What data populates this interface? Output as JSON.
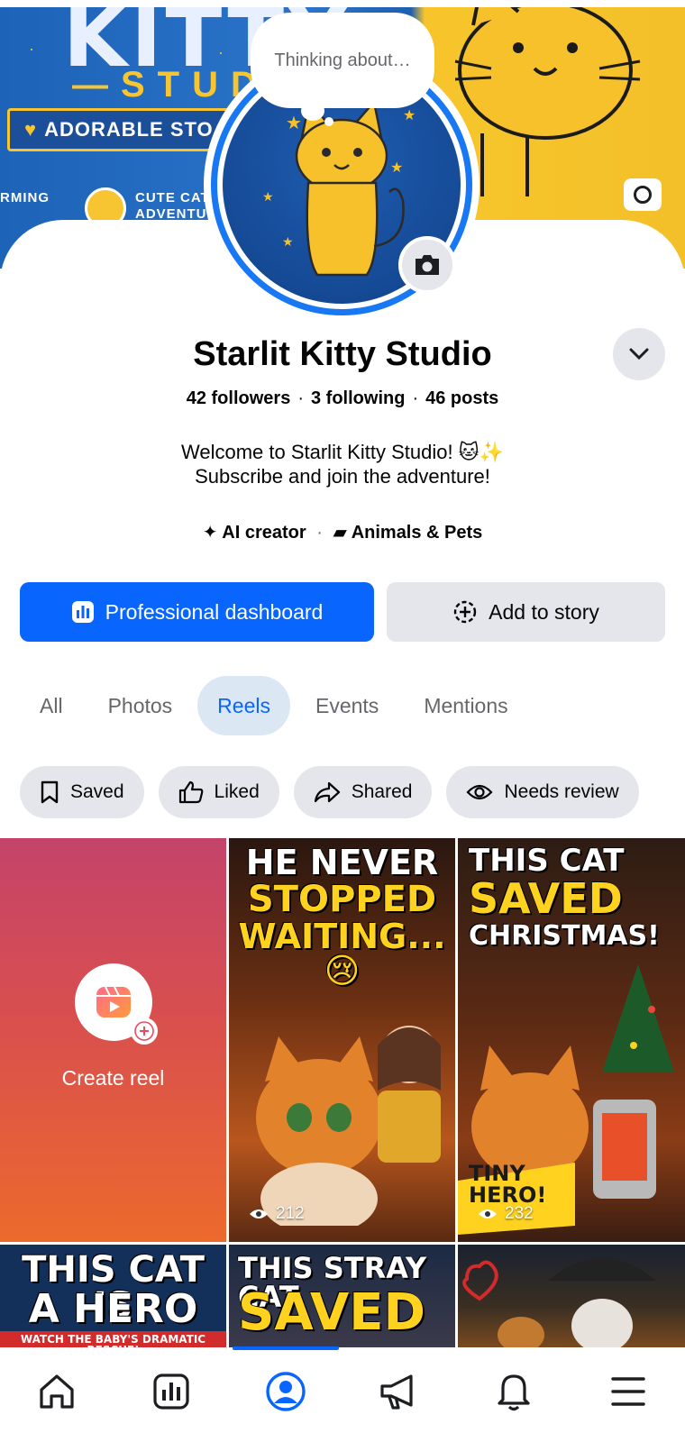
{
  "cover": {
    "banner_text": "KITTY",
    "studio_text": "—STUD",
    "adorable_text": "ADORABLE STO",
    "left_small_text": "RMING",
    "cute_text_line1": "CUTE CAT",
    "cute_text_line2": "ADVENTUR"
  },
  "thought_bubble": "Thinking about…",
  "profile": {
    "name": "Starlit Kitty Studio",
    "followers": "42 followers",
    "following": "3 following",
    "posts": "46 posts",
    "bio_line1": "Welcome to Starlit Kitty Studio! 🐱✨",
    "bio_line2": "Subscribe and join the adventure!",
    "tag_creator": "AI creator",
    "tag_category": "Animals & Pets"
  },
  "actions": {
    "dashboard_label": "Professional dashboard",
    "story_label": "Add to story"
  },
  "tabs": [
    {
      "label": "All",
      "active": false
    },
    {
      "label": "Photos",
      "active": false
    },
    {
      "label": "Reels",
      "active": true
    },
    {
      "label": "Events",
      "active": false
    },
    {
      "label": "Mentions",
      "active": false
    }
  ],
  "filters": [
    {
      "label": "Saved",
      "icon": "bookmark-icon"
    },
    {
      "label": "Liked",
      "icon": "thumbs-up-icon"
    },
    {
      "label": "Shared",
      "icon": "share-icon"
    },
    {
      "label": "Needs review",
      "icon": "eye-icon"
    }
  ],
  "reels": {
    "create_label": "Create reel",
    "items": [
      {
        "title_line1": "HE NEVER",
        "title_line2": "STOPPED",
        "title_line3": "WAITING...😢",
        "views": "212"
      },
      {
        "title_line1": "THIS CAT",
        "title_line2": "SAVED",
        "title_line3": "CHRISTMAS!",
        "badge": "TINY HERO!",
        "views": "232"
      },
      {
        "title_line1": "THIS CAT IS",
        "title_line2": "A HERO",
        "subtitle": "WATCH THE BABY'S DRAMATIC RESCUE!"
      },
      {
        "title_line1": "THIS STRAY CAT",
        "title_line2": "SAVED"
      },
      {
        "title_line1": ""
      }
    ]
  },
  "colors": {
    "brand_blue": "#0866ff",
    "tab_active_bg": "#dbe7f2",
    "chip_bg": "#e4e6eb"
  },
  "nav": [
    {
      "name": "home-icon"
    },
    {
      "name": "dashboard-icon"
    },
    {
      "name": "profile-icon",
      "active": true
    },
    {
      "name": "megaphone-icon"
    },
    {
      "name": "bell-icon"
    },
    {
      "name": "menu-icon"
    }
  ]
}
